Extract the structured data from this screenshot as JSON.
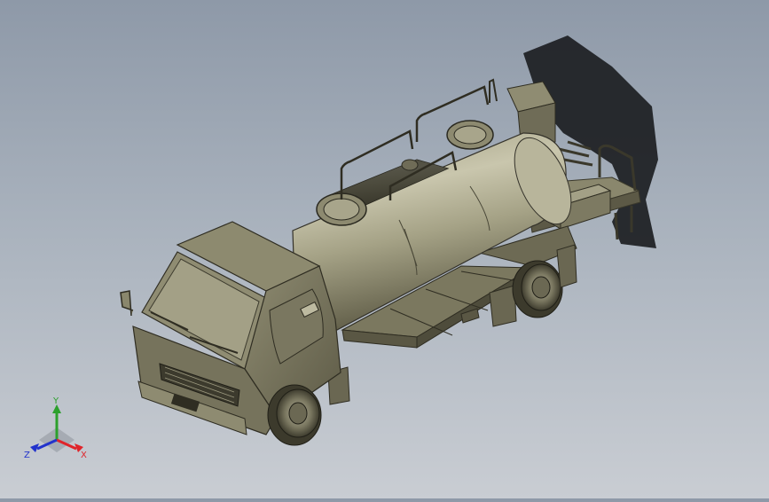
{
  "viewport": {
    "background_top": "#8e99a8",
    "background_bottom": "#c9cdd3",
    "model": "tanker-truck"
  },
  "triad": {
    "x_label": "X",
    "y_label": "Y",
    "z_label": "Z",
    "x_color": "#e0242a",
    "y_color": "#2ca02c",
    "z_color": "#2233cc"
  }
}
